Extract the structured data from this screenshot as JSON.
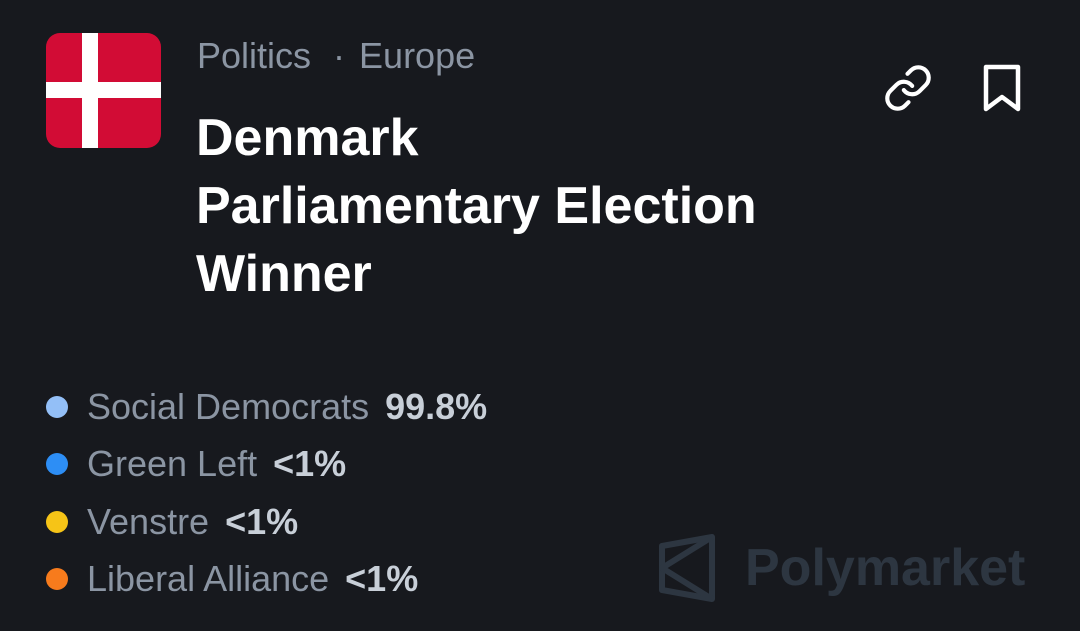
{
  "market": {
    "flag_icon": "denmark-flag-icon",
    "flag_colors": {
      "red": "#d20c35",
      "cross": "#ffffff"
    },
    "breadcrumb": {
      "category": "Politics",
      "separator": "·",
      "region": "Europe"
    },
    "title_lines": [
      "Denmark",
      "Parliamentary Election",
      "Winner"
    ]
  },
  "actions": {
    "link_icon": "link-icon",
    "bookmark_icon": "bookmark-icon"
  },
  "outcomes": [
    {
      "name": "Social Democrats",
      "percent": "99.8%",
      "color": "#93bff7"
    },
    {
      "name": "Green Left",
      "percent": "<1%",
      "color": "#2d8ef5"
    },
    {
      "name": "Venstre",
      "percent": "<1%",
      "color": "#f6c417"
    },
    {
      "name": "Liberal Alliance",
      "percent": "<1%",
      "color": "#f77b1c"
    }
  ],
  "watermark": {
    "icon": "polymarket-logo-icon",
    "text": "Polymarket"
  },
  "theme": {
    "background": "#17191e",
    "muted_text": "#8b95a3",
    "title_text": "#ffffff"
  }
}
